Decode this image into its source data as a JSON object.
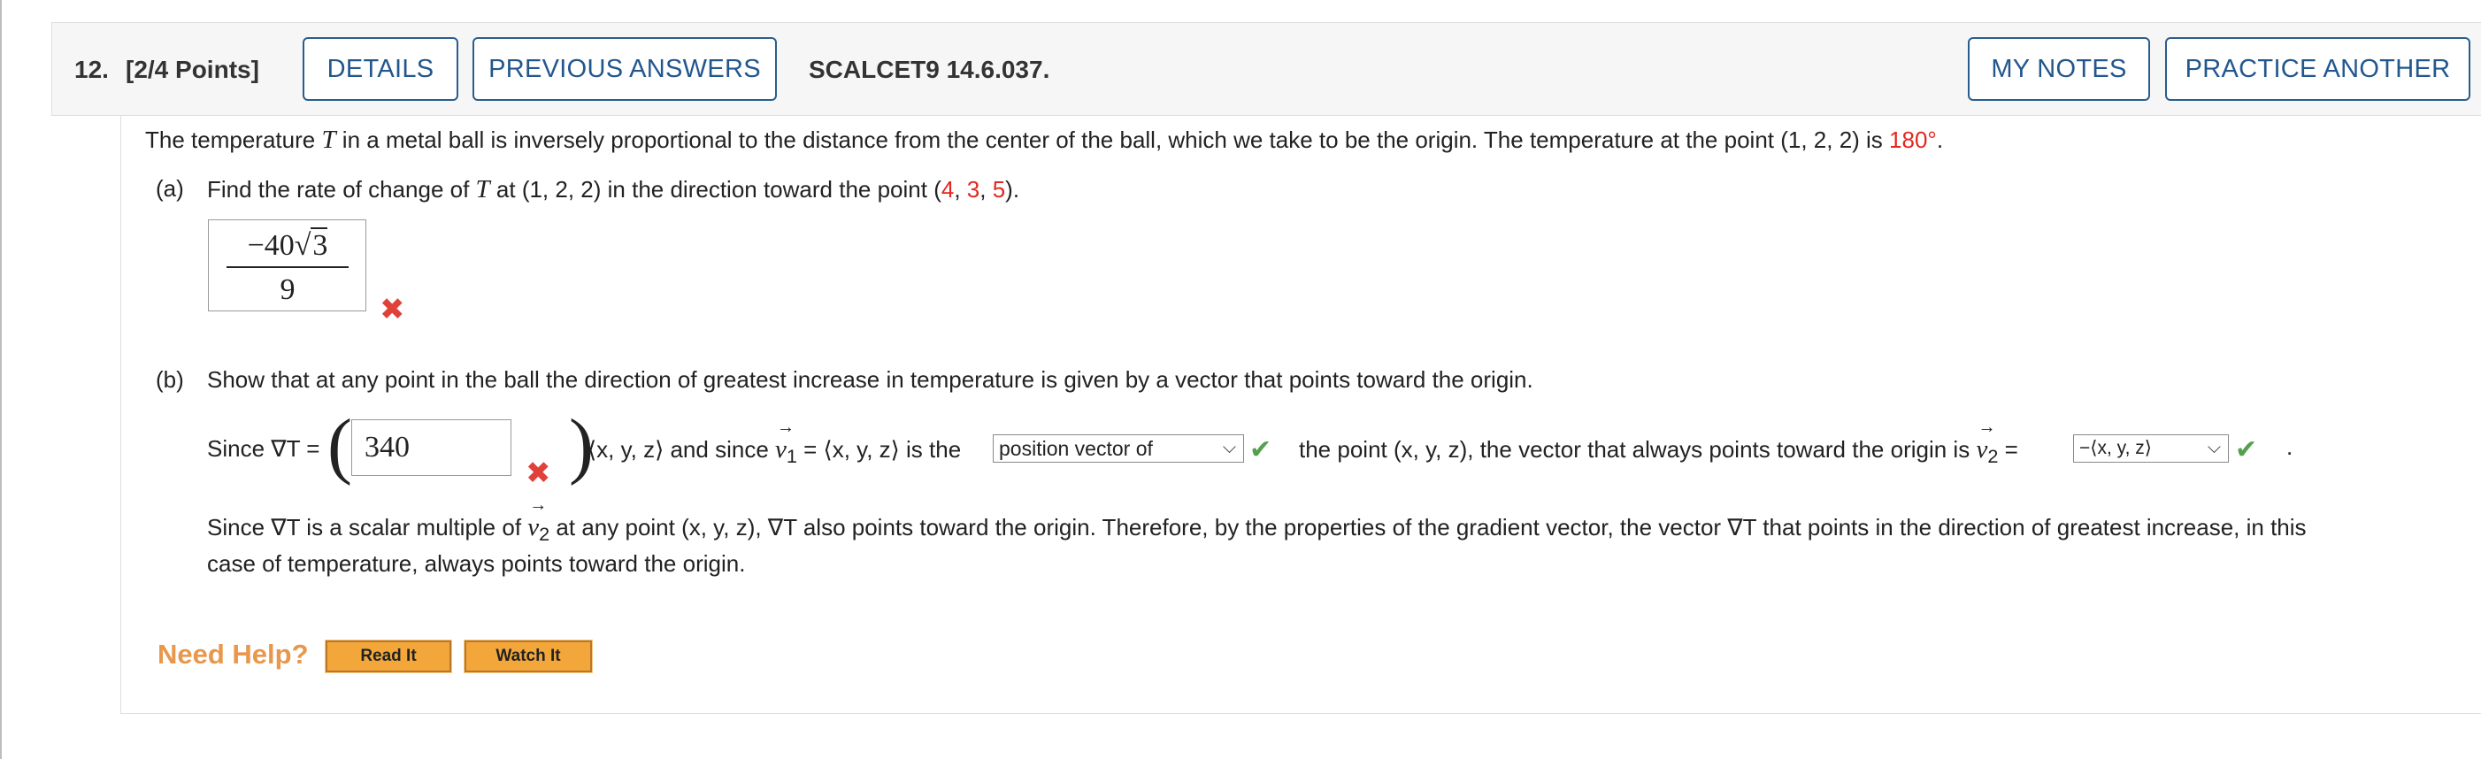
{
  "header": {
    "question_number": "12.",
    "points": "[2/4 Points]",
    "details_label": "DETAILS",
    "previous_answers_label": "PREVIOUS ANSWERS",
    "reference": "SCALCET9 14.6.037.",
    "my_notes_label": "MY NOTES",
    "practice_another_label": "PRACTICE ANOTHER"
  },
  "problem": {
    "intro_1": "The temperature ",
    "intro_T": "T",
    "intro_2": " in a metal ball is inversely proportional to the distance from the center of the ball, which we take to be the origin. The temperature at the point (1, 2, 2) is ",
    "intro_temp": "180°",
    "intro_3": "."
  },
  "part_a": {
    "label": "(a)",
    "text_1": "Find the rate of change of ",
    "text_T": "T",
    "text_2": " at (1, 2, 2) in the direction toward the point (",
    "pt_x": "4",
    "pt_y": "3",
    "pt_z": "5",
    "text_3": ").",
    "answer_num_coef": "−40",
    "answer_num_rad": "3",
    "answer_den": "9",
    "status_icon": "x-mark-icon"
  },
  "part_b": {
    "label": "(b)",
    "text": "Show that at any point in the ball the direction of greatest increase in temperature is given by a vector that points toward the origin.",
    "since_label": "Since ∇T =",
    "input_value": "340",
    "after_paren": "⟨x, y, z⟩ and since ",
    "v1": "v",
    "v1_sub": "1",
    "eq_xyz": " = ⟨x, y, z⟩ is the ",
    "select_1": "position vector of",
    "mid_text": "the point (x, y, z), the vector that always points toward the origin is ",
    "v2": "v",
    "v2_sub": "2",
    "eq": " =",
    "select_2": "−⟨x, y, z⟩",
    "period": ".",
    "conclusion_1": "Since ∇T is a scalar multiple of ",
    "conclusion_2": " at any point (x, y, z), ∇T also points toward the origin. Therefore, by the properties of the gradient vector, the vector ∇T that points in the direction of greatest increase, in this",
    "conclusion_3": "case of temperature, always points toward the origin."
  },
  "help": {
    "label": "Need Help?",
    "read_it": "Read It",
    "watch_it": "Watch It"
  },
  "colors": {
    "link_blue": "#22578e",
    "red_value": "#e3261f",
    "incorrect": "#e0413a",
    "correct": "#55a04f",
    "help_orange": "#e8974b",
    "button_orange": "#f3a73b"
  }
}
